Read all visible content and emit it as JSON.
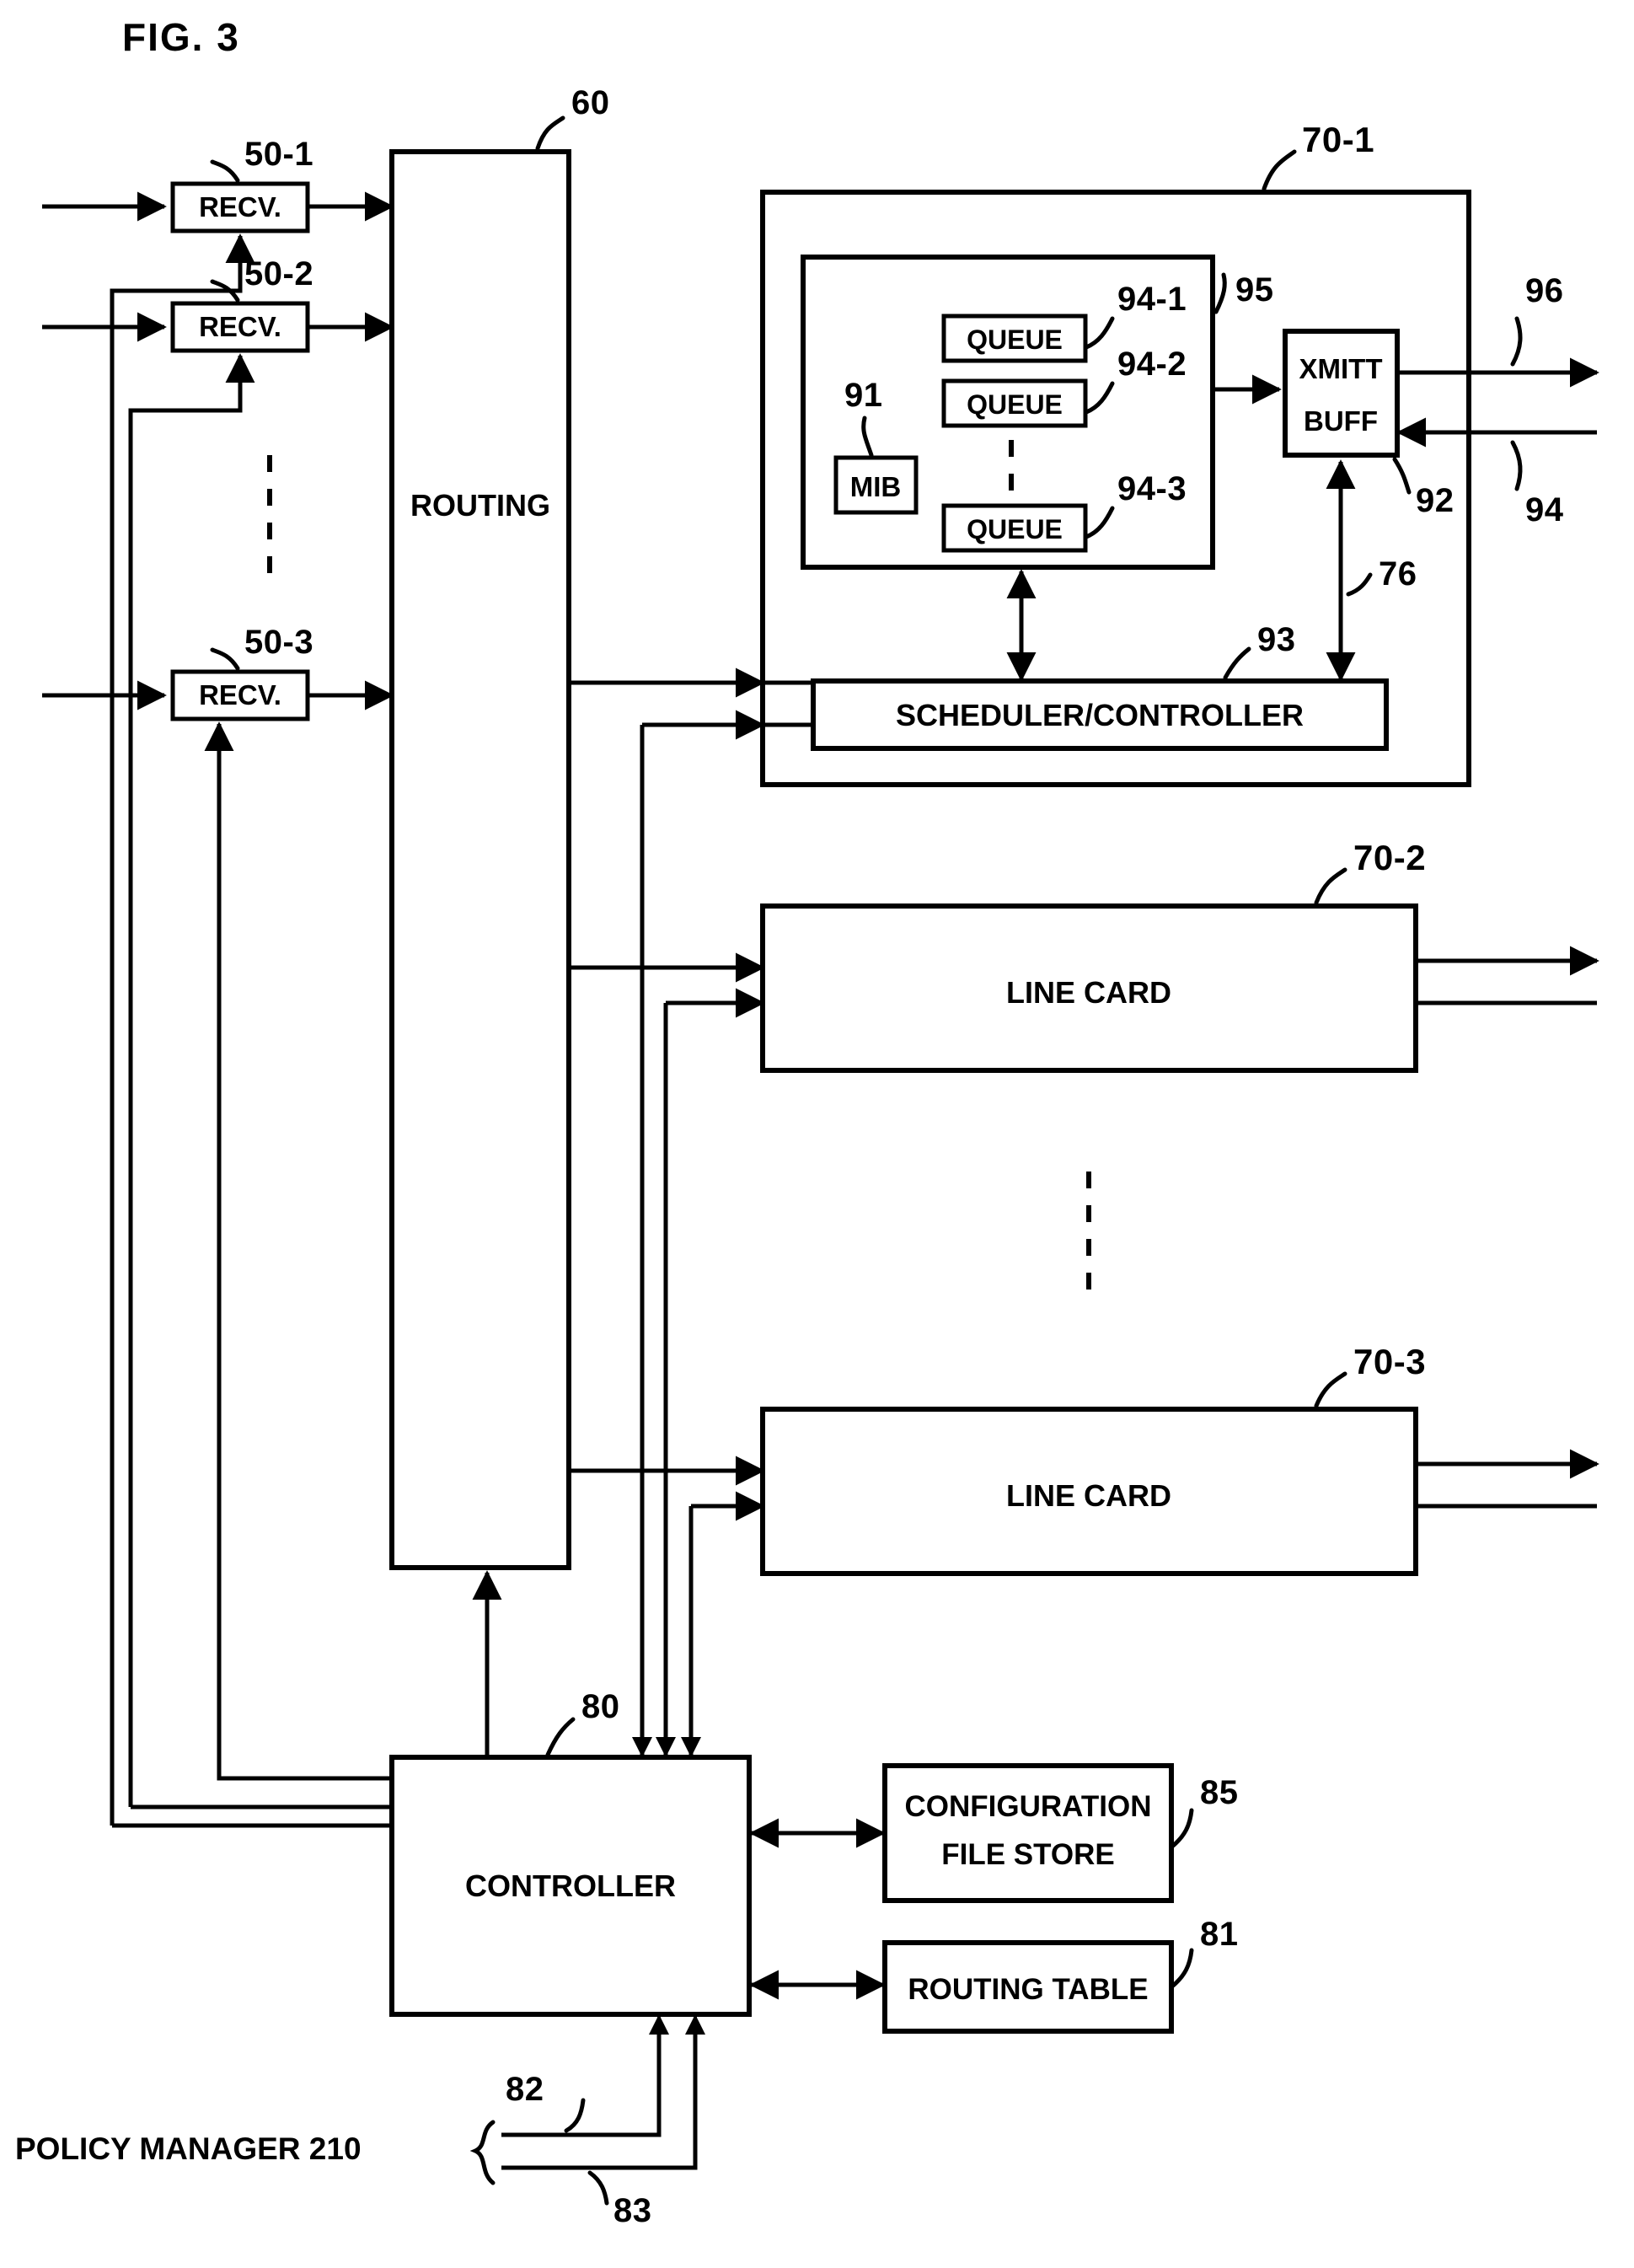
{
  "figure": {
    "title": "FIG. 3",
    "domain_note": "patent block diagram of a router with line cards"
  },
  "blocks": {
    "receivers": [
      {
        "label": "RECV.",
        "ref": "50-1"
      },
      {
        "label": "RECV.",
        "ref": "50-2"
      },
      {
        "label": "RECV.",
        "ref": "50-3"
      }
    ],
    "routing": {
      "label": "ROUTING",
      "ref": "60"
    },
    "line_card_1": {
      "ref": "70-1",
      "inner_group_ref": "95",
      "mib": {
        "label": "MIB",
        "ref": "91"
      },
      "queues": [
        {
          "label": "QUEUE",
          "ref": "94-1"
        },
        {
          "label": "QUEUE",
          "ref": "94-2"
        },
        {
          "label": "QUEUE",
          "ref": "94-3"
        }
      ],
      "xmitt_buff": {
        "label_line1": "XMITT",
        "label_line2": "BUFF",
        "ref": "92"
      },
      "scheduler": {
        "label": "SCHEDULER/CONTROLLER",
        "ref": "93"
      },
      "link_refs": {
        "feedback": "76",
        "egress": "96",
        "ingress": "94"
      }
    },
    "line_card_2": {
      "label": "LINE CARD",
      "ref": "70-2"
    },
    "line_card_3": {
      "label": "LINE CARD",
      "ref": "70-3"
    },
    "controller": {
      "label": "CONTROLLER",
      "ref": "80"
    },
    "config_file_store": {
      "label_line1": "CONFIGURATION",
      "label_line2": "FILE STORE",
      "ref": "85"
    },
    "routing_table": {
      "label": "ROUTING TABLE",
      "ref": "81"
    },
    "policy_manager": {
      "label": "POLICY MANAGER 210",
      "link_refs": [
        "82",
        "83"
      ]
    }
  },
  "reference_numerals": {
    "n50_1": "50-1",
    "n50_2": "50-2",
    "n50_3": "50-3",
    "n60": "60",
    "n70_1": "70-1",
    "n70_2": "70-2",
    "n70_3": "70-3",
    "n76": "76",
    "n80": "80",
    "n81": "81",
    "n82": "82",
    "n83": "83",
    "n85": "85",
    "n91": "91",
    "n92": "92",
    "n93": "93",
    "n94": "94",
    "n94_1": "94-1",
    "n94_2": "94-2",
    "n94_3": "94-3",
    "n95": "95",
    "n96": "96"
  },
  "colors": {
    "ink": "#000000",
    "paper": "#ffffff"
  }
}
